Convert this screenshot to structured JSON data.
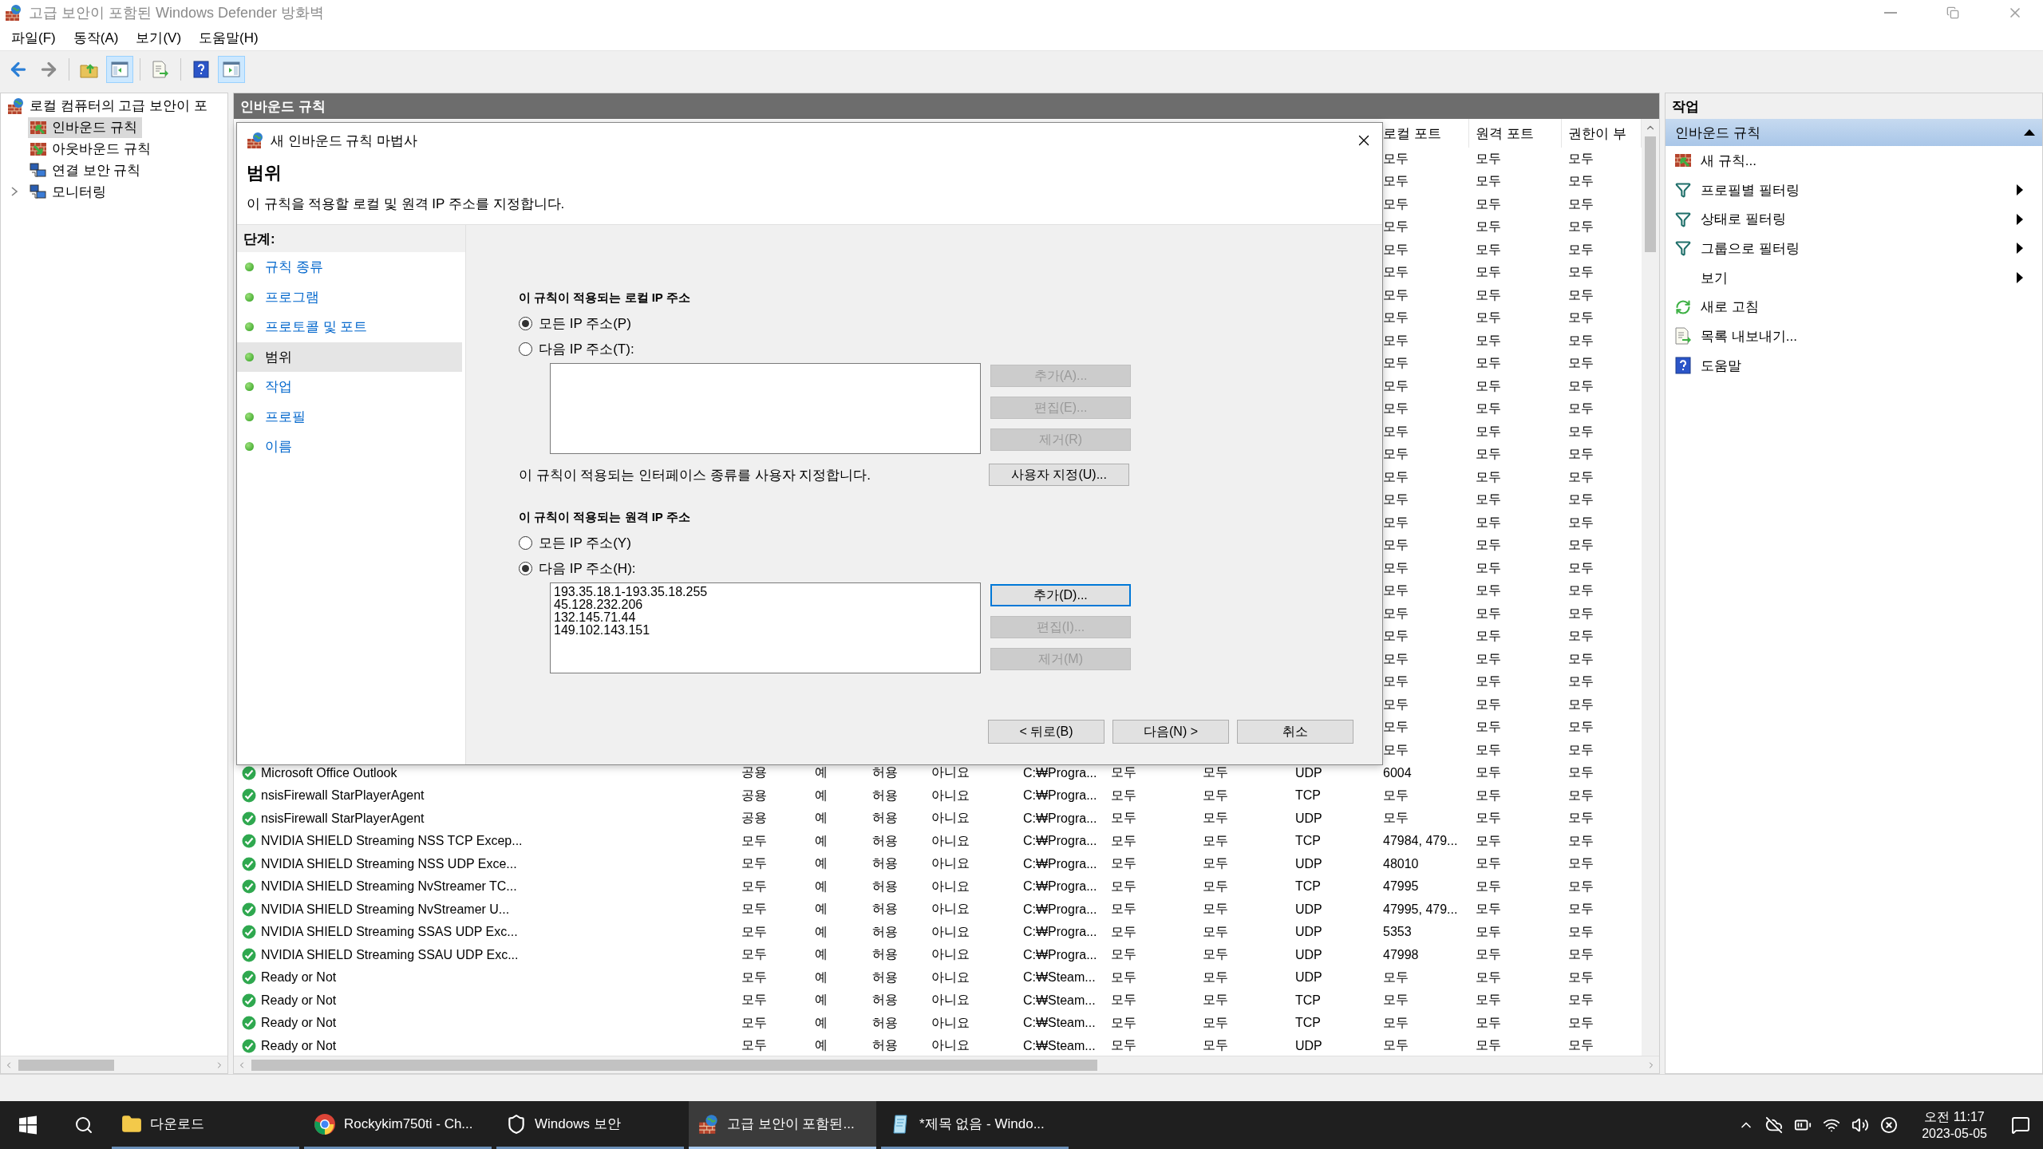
{
  "window": {
    "title": "고급 보안이 포함된 Windows Defender 방화벽"
  },
  "menu": [
    "파일(F)",
    "동작(A)",
    "보기(V)",
    "도움말(H)"
  ],
  "toolbar": [
    {
      "kind": "back",
      "pressed": false
    },
    {
      "kind": "forward",
      "pressed": false
    },
    {
      "kind": "up",
      "pressed": false
    },
    {
      "kind": "tree",
      "pressed": true
    },
    {
      "kind": "export",
      "pressed": false
    },
    {
      "kind": "help",
      "pressed": false
    },
    {
      "kind": "pane",
      "pressed": true
    }
  ],
  "tree": {
    "label": "로컬 컴퓨터의 고급 보안이 포",
    "kind": "firewall",
    "selected": false,
    "children": [
      {
        "label": "인바운드 규칙",
        "kind": "inbound",
        "selected": true
      },
      {
        "label": "아웃바운드 규칙",
        "kind": "outbound",
        "selected": false
      },
      {
        "label": "연결 보안 규칙",
        "kind": "connection",
        "selected": false
      },
      {
        "label": "모니터링",
        "kind": "monitor",
        "selected": false,
        "expanded": false
      }
    ]
  },
  "center": {
    "title": "인바운드 규칙",
    "columns": [
      "로컬 포트",
      "원격 포트",
      "권한이 부"
    ],
    "rows": [
      {
        "cells": [
          "모두",
          "모두",
          "모두"
        ]
      },
      {
        "cells": [
          "모두",
          "모두",
          "모두"
        ]
      },
      {
        "cells": [
          "모두",
          "모두",
          "모두"
        ]
      },
      {
        "cells": [
          "모두",
          "모두",
          "모두"
        ]
      },
      {
        "cells": [
          "모두",
          "모두",
          "모두"
        ]
      },
      {
        "cells": [
          "모두",
          "모두",
          "모두"
        ]
      },
      {
        "cells": [
          "모두",
          "모두",
          "모두"
        ]
      },
      {
        "cells": [
          "모두",
          "모두",
          "모두"
        ]
      },
      {
        "cells": [
          "모두",
          "모두",
          "모두"
        ]
      },
      {
        "cells": [
          "모두",
          "모두",
          "모두"
        ]
      },
      {
        "cells": [
          "모두",
          "모두",
          "모두"
        ]
      },
      {
        "cells": [
          "모두",
          "모두",
          "모두"
        ]
      },
      {
        "cells": [
          "모두",
          "모두",
          "모두"
        ]
      },
      {
        "cells": [
          "모두",
          "모두",
          "모두"
        ]
      },
      {
        "cells": [
          "모두",
          "모두",
          "모두"
        ]
      },
      {
        "cells": [
          "모두",
          "모두",
          "모두"
        ]
      },
      {
        "cells": [
          "모두",
          "모두",
          "모두"
        ]
      },
      {
        "cells": [
          "모두",
          "모두",
          "모두"
        ]
      },
      {
        "cells": [
          "모두",
          "모두",
          "모두"
        ]
      },
      {
        "cells": [
          "모두",
          "모두",
          "모두"
        ]
      },
      {
        "cells": [
          "모두",
          "모두",
          "모두"
        ]
      },
      {
        "cells": [
          "모두",
          "모두",
          "모두"
        ]
      },
      {
        "cells": [
          "모두",
          "모두",
          "모두"
        ]
      },
      {
        "cells": [
          "모두",
          "모두",
          "모두"
        ]
      },
      {
        "cells": [
          "모두",
          "모두",
          "모두"
        ]
      },
      {
        "cells": [
          "모두",
          "모두",
          "모두"
        ]
      },
      {
        "cells": [
          "모두",
          "모두",
          "모두"
        ]
      },
      {
        "name": "Microsoft Office Outlook",
        "cells": [
          "공용",
          "예",
          "허용",
          "아니요",
          "C:₩Progra...",
          "모두",
          "모두",
          "UDP",
          "6004",
          "모두",
          "모두"
        ]
      },
      {
        "name": "nsisFirewall StarPlayerAgent",
        "cells": [
          "공용",
          "예",
          "허용",
          "아니요",
          "C:₩Progra...",
          "모두",
          "모두",
          "TCP",
          "모두",
          "모두",
          "모두"
        ]
      },
      {
        "name": "nsisFirewall StarPlayerAgent",
        "cells": [
          "공용",
          "예",
          "허용",
          "아니요",
          "C:₩Progra...",
          "모두",
          "모두",
          "UDP",
          "모두",
          "모두",
          "모두"
        ]
      },
      {
        "name": "NVIDIA SHIELD Streaming NSS TCP Excep...",
        "cells": [
          "모두",
          "예",
          "허용",
          "아니요",
          "C:₩Progra...",
          "모두",
          "모두",
          "TCP",
          "47984, 479...",
          "모두",
          "모두"
        ]
      },
      {
        "name": "NVIDIA SHIELD Streaming NSS UDP Exce...",
        "cells": [
          "모두",
          "예",
          "허용",
          "아니요",
          "C:₩Progra...",
          "모두",
          "모두",
          "UDP",
          "48010",
          "모두",
          "모두"
        ]
      },
      {
        "name": "NVIDIA SHIELD Streaming NvStreamer TC...",
        "cells": [
          "모두",
          "예",
          "허용",
          "아니요",
          "C:₩Progra...",
          "모두",
          "모두",
          "TCP",
          "47995",
          "모두",
          "모두"
        ]
      },
      {
        "name": "NVIDIA SHIELD Streaming NvStreamer U...",
        "cells": [
          "모두",
          "예",
          "허용",
          "아니요",
          "C:₩Progra...",
          "모두",
          "모두",
          "UDP",
          "47995, 479...",
          "모두",
          "모두"
        ]
      },
      {
        "name": "NVIDIA SHIELD Streaming SSAS UDP Exc...",
        "cells": [
          "모두",
          "예",
          "허용",
          "아니요",
          "C:₩Progra...",
          "모두",
          "모두",
          "UDP",
          "5353",
          "모두",
          "모두"
        ]
      },
      {
        "name": "NVIDIA SHIELD Streaming SSAU UDP Exc...",
        "cells": [
          "모두",
          "예",
          "허용",
          "아니요",
          "C:₩Progra...",
          "모두",
          "모두",
          "UDP",
          "47998",
          "모두",
          "모두"
        ]
      },
      {
        "name": "Ready or Not",
        "cells": [
          "모두",
          "예",
          "허용",
          "아니요",
          "C:₩Steam...",
          "모두",
          "모두",
          "UDP",
          "모두",
          "모두",
          "모두"
        ]
      },
      {
        "name": "Ready or Not",
        "cells": [
          "모두",
          "예",
          "허용",
          "아니요",
          "C:₩Steam...",
          "모두",
          "모두",
          "TCP",
          "모두",
          "모두",
          "모두"
        ]
      },
      {
        "name": "Ready or Not",
        "cells": [
          "모두",
          "예",
          "허용",
          "아니요",
          "C:₩Steam...",
          "모두",
          "모두",
          "TCP",
          "모두",
          "모두",
          "모두"
        ]
      },
      {
        "name": "Ready or Not",
        "cells": [
          "모두",
          "예",
          "허용",
          "아니요",
          "C:₩Steam...",
          "모두",
          "모두",
          "UDP",
          "모두",
          "모두",
          "모두"
        ]
      }
    ]
  },
  "wizard": {
    "title": "새 인바운드 규칙 마법사",
    "heading": "범위",
    "description": "이 규칙을 적용할 로컬 및 원격 IP 주소를 지정합니다.",
    "steps_label": "단계:",
    "steps": [
      {
        "label": "규칙 종류",
        "selected": false
      },
      {
        "label": "프로그램",
        "selected": false
      },
      {
        "label": "프로토콜 및 포트",
        "selected": false
      },
      {
        "label": "범위",
        "selected": true
      },
      {
        "label": "작업",
        "selected": false
      },
      {
        "label": "프로필",
        "selected": false
      },
      {
        "label": "이름",
        "selected": false
      }
    ],
    "local": {
      "label": "이 규칙이 적용되는 로컬 IP 주소",
      "options": [
        {
          "label": "모든 IP 주소(P)",
          "selected": true
        },
        {
          "label": "다음 IP 주소(T):",
          "selected": false
        }
      ],
      "buttons": [
        {
          "label": "추가(A)...",
          "disabled": true,
          "focused": false
        },
        {
          "label": "편집(E)...",
          "disabled": true,
          "focused": false
        },
        {
          "label": "제거(R)",
          "disabled": true,
          "focused": false
        }
      ]
    },
    "interface": {
      "text": "이 규칙이 적용되는 인터페이스 종류를 사용자 지정합니다.",
      "button": "사용자 지정(U)..."
    },
    "remote": {
      "label": "이 규칙이 적용되는 원격 IP 주소",
      "options": [
        {
          "label": "모든 IP 주소(Y)",
          "selected": false
        },
        {
          "label": "다음 IP 주소(H):",
          "selected": true
        }
      ],
      "addresses": [
        "193.35.18.1-193.35.18.255",
        "45.128.232.206",
        "132.145.71.44",
        "149.102.143.151"
      ],
      "buttons": [
        {
          "label": "추가(D)...",
          "disabled": false,
          "focused": true
        },
        {
          "label": "편집(I)...",
          "disabled": true,
          "focused": false
        },
        {
          "label": "제거(M)",
          "disabled": true,
          "focused": false
        }
      ]
    },
    "footer": [
      "< 뒤로(B)",
      "다음(N) >",
      "취소"
    ]
  },
  "actions": {
    "title": "작업",
    "section": {
      "title": "인바운드 규칙",
      "expanded": true
    },
    "items": [
      {
        "label": "새 규칙...",
        "kind": "rule",
        "submenu": false
      },
      {
        "label": "프로필별 필터링",
        "kind": "filter",
        "submenu": true
      },
      {
        "label": "상태로 필터링",
        "kind": "filter",
        "submenu": true
      },
      {
        "label": "그룹으로 필터링",
        "kind": "filter",
        "submenu": true
      },
      {
        "label": "보기",
        "kind": "plain",
        "submenu": true
      },
      {
        "label": "새로 고침",
        "kind": "refresh",
        "submenu": false
      },
      {
        "label": "목록 내보내기...",
        "kind": "export",
        "submenu": false
      },
      {
        "label": "도움말",
        "kind": "help",
        "submenu": false
      }
    ]
  },
  "taskbar": {
    "items": [
      {
        "label": "다운로드",
        "kind": "folder",
        "active": false
      },
      {
        "label": "Rockykim750ti - Ch...",
        "kind": "browser",
        "active": false
      },
      {
        "label": "Windows 보안",
        "kind": "shield",
        "active": false
      },
      {
        "label": "고급 보안이 포함된...",
        "kind": "firewall",
        "active": true
      },
      {
        "label": "*제목 없음 - Windo...",
        "kind": "notepad",
        "active": false
      }
    ],
    "time": "오전 11:17",
    "date": "2023-05-05"
  }
}
